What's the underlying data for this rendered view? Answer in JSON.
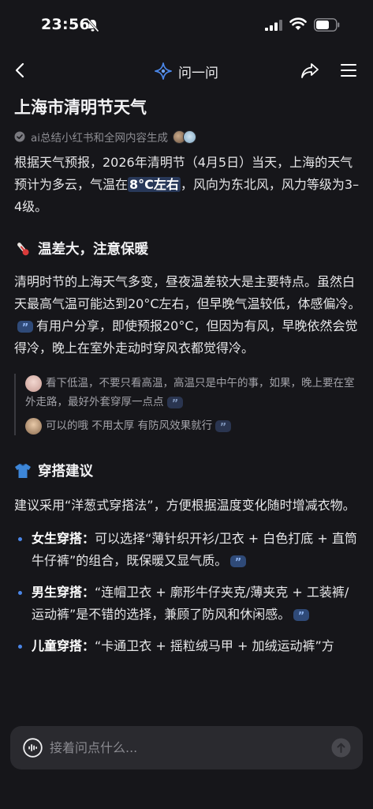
{
  "status_bar": {
    "time": "23:56"
  },
  "nav": {
    "title": "问一问",
    "back_icon": "chevron-left-icon",
    "share_icon": "share-icon",
    "menu_icon": "menu-icon"
  },
  "article": {
    "title": "上海市清明节天气",
    "source": "ai总结小红书和全网内容生成",
    "intro_before": "根据天气预报，2026年清明节（4月5日）当天，上海的天气预计为多云，气温在",
    "intro_highlight": "8°C左右",
    "intro_after": "，风向为东北风，风力等级为3–4级。",
    "section1": {
      "heading": "温差大，注意保暖",
      "para_before": "清明时节的上海天气多变，昼夜温差较大是主要特点。虽然白天最高气温可能达到20°C左右，但早晚气温较低，体感偏冷。",
      "para_after": "有用户分享，即使预报20°C，但因为有风，早晚依然会觉得冷，晚上在室外走动时穿风衣都觉得冷。",
      "comments": [
        {
          "text": "看下低温，不要只看高温，高温只是中午的事，如果，晚上要在室外走路，最好外套穿厚一点点"
        },
        {
          "text": "可以的哦 不用太厚 有防风效果就行"
        }
      ]
    },
    "section2": {
      "heading": "穿搭建议",
      "para": "建议采用“洋葱式穿搭法”，方便根据温度变化随时增减衣物。",
      "tips": [
        {
          "label": "女生穿搭：",
          "text": "可以选择“薄针织开衫/卫衣 + 白色打底 + 直筒牛仔裤”的组合，既保暖又显气质。"
        },
        {
          "label": "男生穿搭：",
          "text": "“连帽卫衣 + 廓形牛仔夹克/薄夹克 + 工装裤/运动裤”是不错的选择，兼顾了防风和休闲感。"
        },
        {
          "label": "儿童穿搭：",
          "text": "“卡通卫衣 + 摇粒绒马甲 + 加绒运动裤”方"
        }
      ]
    }
  },
  "input_bar": {
    "placeholder": "接着问点什么..."
  },
  "colors": {
    "background": "#16161a",
    "accent": "#4a86e8",
    "quote_badge": "#2f4a78"
  }
}
